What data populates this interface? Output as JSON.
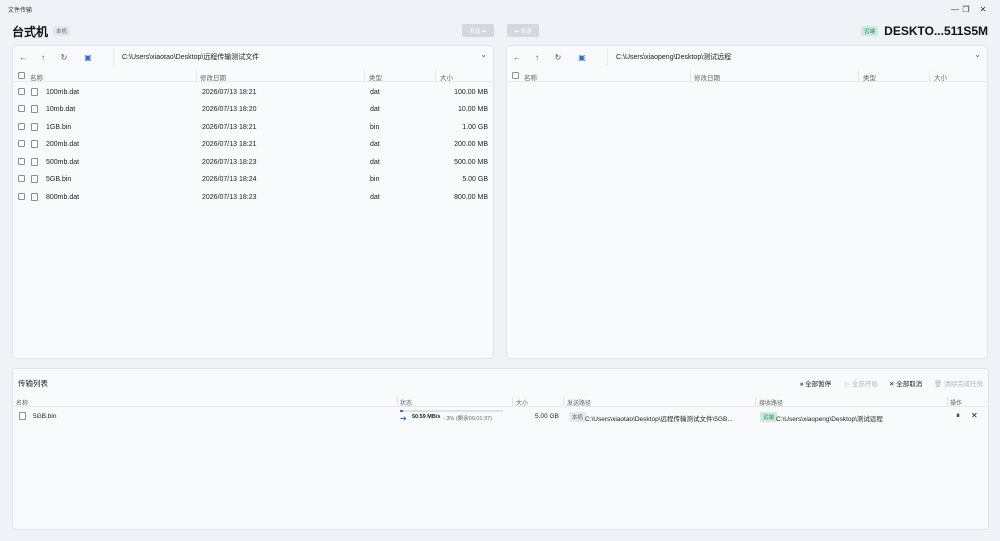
{
  "window": {
    "title": "文件传输",
    "controls": [
      "—",
      "❐",
      "✕"
    ]
  },
  "local": {
    "name": "台式机",
    "tag": "本机",
    "path": "C:\\Users\\xiaotao\\Desktop\\远程传输测试文件",
    "columns": {
      "name": "名称",
      "modified": "修改日期",
      "type": "类型",
      "size": "大小"
    },
    "files": [
      {
        "name": "100mb.dat",
        "modified": "2026/07/13 18:21",
        "type": "dat",
        "size": "100.00 MB"
      },
      {
        "name": "10mb.dat",
        "modified": "2026/07/13 18:20",
        "type": "dat",
        "size": "10.00 MB"
      },
      {
        "name": "1GB.bin",
        "modified": "2026/07/13 18:21",
        "type": "bin",
        "size": "1.00 GB"
      },
      {
        "name": "200mb.dat",
        "modified": "2026/07/13 18:21",
        "type": "dat",
        "size": "200.00 MB"
      },
      {
        "name": "500mb.dat",
        "modified": "2026/07/13 18:23",
        "type": "dat",
        "size": "500.00 MB"
      },
      {
        "name": "5GB.bin",
        "modified": "2026/07/13 18:24",
        "type": "bin",
        "size": "5.00 GB"
      },
      {
        "name": "800mb.dat",
        "modified": "2026/07/13 18:23",
        "type": "dat",
        "size": "800.00 MB"
      }
    ]
  },
  "remote": {
    "name": "DESKTO...511S5M",
    "tag": "远端",
    "path": "C:\\Users\\xiaopeng\\Desktop\\测试远程",
    "columns": {
      "name": "名称",
      "modified": "修改日期",
      "type": "类型",
      "size": "大小"
    }
  },
  "send_right_label": "发送 ➡",
  "send_left_label": "⬅ 发送",
  "transfers": {
    "title": "传输列表",
    "actions": {
      "pause_all": "全部暂停",
      "start_all": "全部开始",
      "cancel_all": "全部取消",
      "clear_done": "清除完成任务"
    },
    "columns": {
      "name": "名称",
      "status": "状态",
      "size": "大小",
      "src": "发送路径",
      "dst": "接收路径",
      "ops": "操作"
    },
    "items": [
      {
        "name": "5GB.bin",
        "speed": "50.59 MB/s",
        "status_detail": " - 3% (剩余00:01:37)",
        "progress": 0.03,
        "size": "5.00 GB",
        "src_tag": "本机",
        "src_path": "C:\\Users\\xiaotao\\Desktop\\远程传输测试文件\\5GB...",
        "dst_tag": "远端",
        "dst_path": "C:\\Users\\xiaopeng\\Desktop\\测试远程"
      }
    ]
  },
  "colors": {
    "accent": "#2f6ccb",
    "remote_tag_bg": "#cdebdc",
    "remote_tag_fg": "#2d8a57"
  }
}
